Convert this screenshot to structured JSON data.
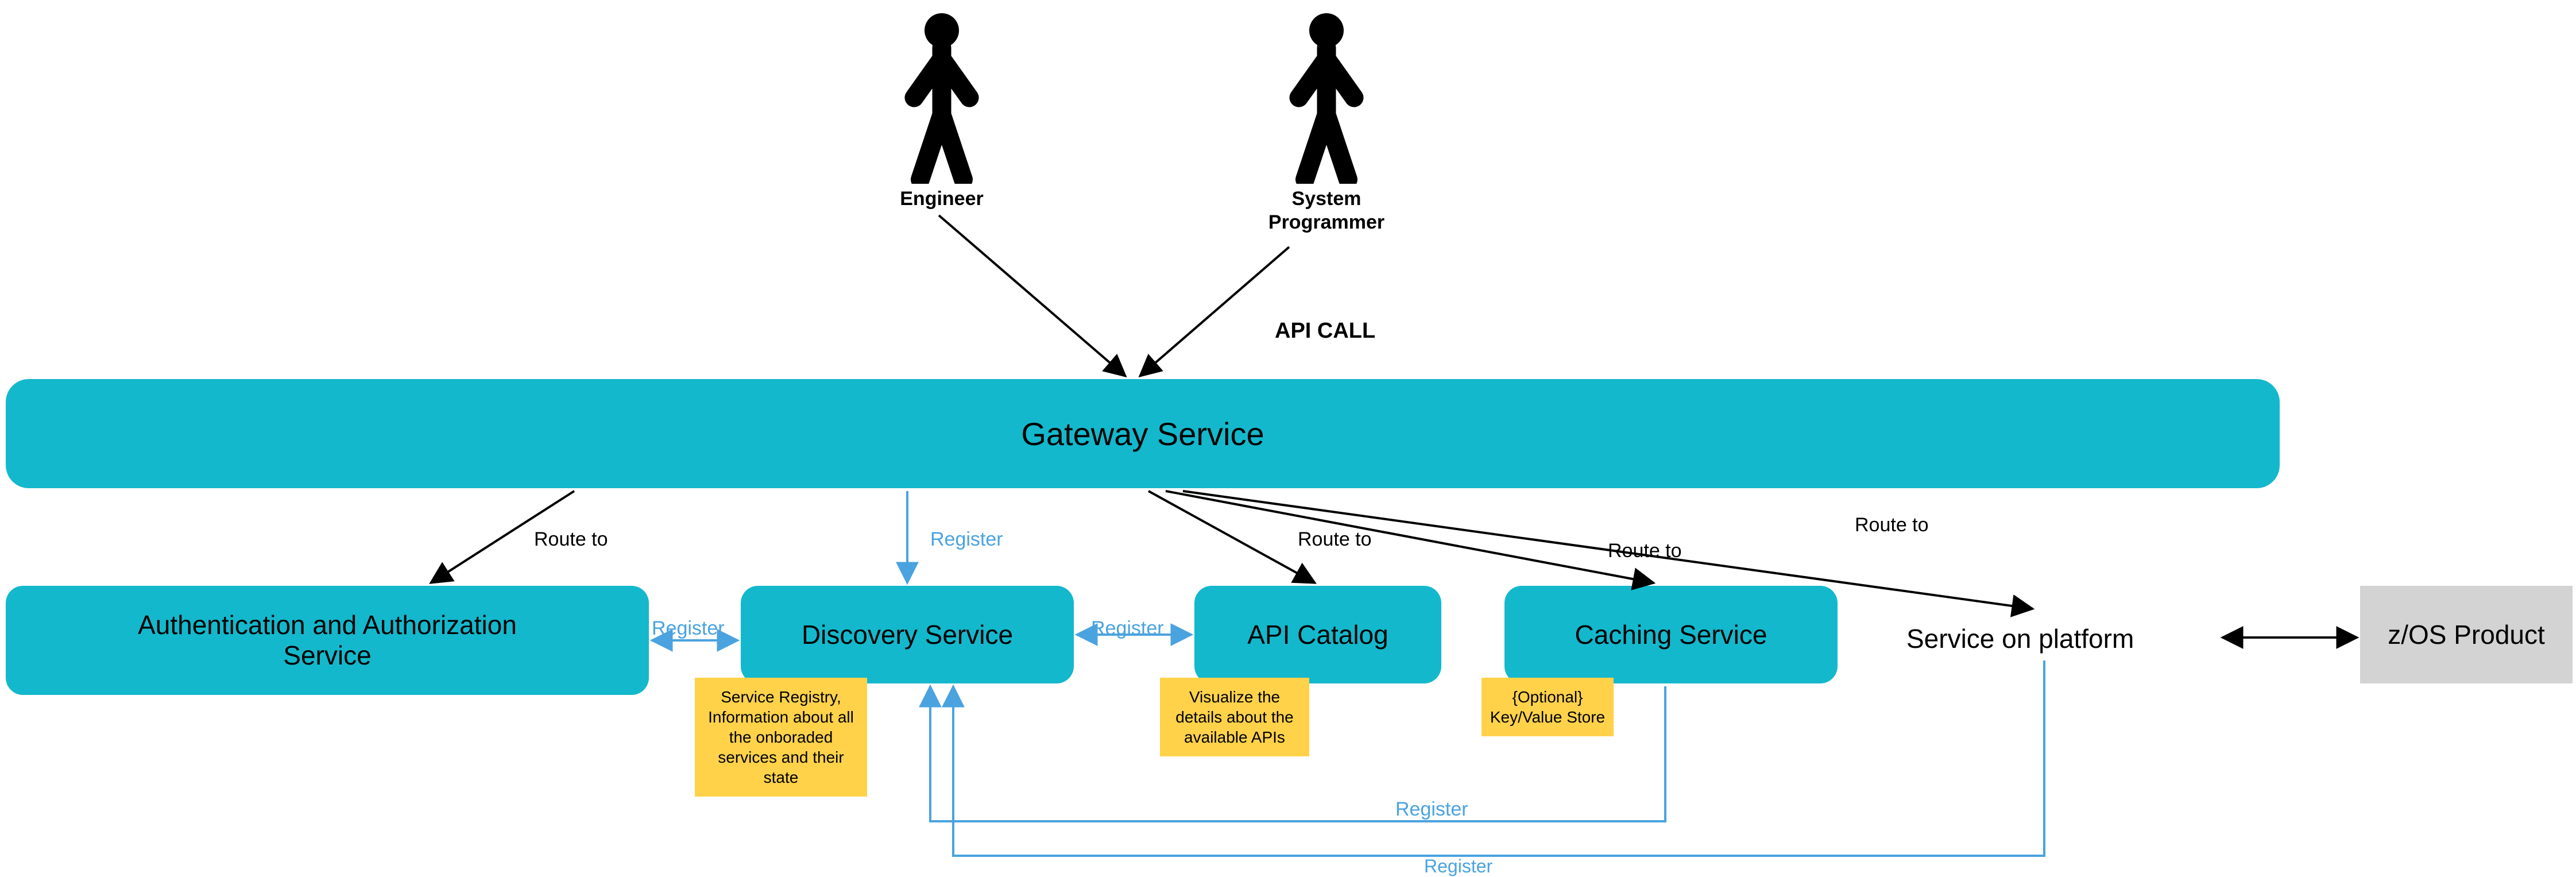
{
  "actors": {
    "engineer": "Engineer",
    "sysprog": "System\nProgrammer"
  },
  "api_call_label": "API CALL",
  "gateway": "Gateway Service",
  "services": {
    "auth": "Authentication and Authorization\nService",
    "discovery": "Discovery Service",
    "api_catalog": "API Catalog",
    "caching": "Caching Service"
  },
  "service_on_platform": "Service on platform",
  "zos": "z/OS Product",
  "notes": {
    "discovery": "Service Registry, Information about all the onboraded services and their state",
    "api_catalog": "Visualize the details about the available APIs",
    "caching": "{Optional} Key/Value Store"
  },
  "edge_labels": {
    "route_to": "Route to",
    "register": "Register"
  },
  "chart_data": {
    "type": "diagram",
    "nodes": [
      {
        "id": "engineer",
        "kind": "actor",
        "label": "Engineer"
      },
      {
        "id": "sysprog",
        "kind": "actor",
        "label": "System Programmer"
      },
      {
        "id": "gateway",
        "kind": "service",
        "label": "Gateway Service"
      },
      {
        "id": "auth",
        "kind": "service",
        "label": "Authentication and Authorization Service"
      },
      {
        "id": "discovery",
        "kind": "service",
        "label": "Discovery Service",
        "note": "Service Registry, Information about all the onboraded services and their state"
      },
      {
        "id": "api_catalog",
        "kind": "service",
        "label": "API Catalog",
        "note": "Visualize the details about the available APIs"
      },
      {
        "id": "caching",
        "kind": "service",
        "label": "Caching Service",
        "note": "{Optional} Key/Value Store"
      },
      {
        "id": "service_on_platform",
        "kind": "platform",
        "label": "Service on platform"
      },
      {
        "id": "zos",
        "kind": "external",
        "label": "z/OS Product"
      }
    ],
    "edges": [
      {
        "from": "engineer",
        "to": "gateway",
        "label": "API CALL"
      },
      {
        "from": "sysprog",
        "to": "gateway",
        "label": "API CALL"
      },
      {
        "from": "gateway",
        "to": "auth",
        "label": "Route to",
        "color": "black"
      },
      {
        "from": "gateway",
        "to": "api_catalog",
        "label": "Route to",
        "color": "black"
      },
      {
        "from": "gateway",
        "to": "caching",
        "label": "Route to",
        "color": "black"
      },
      {
        "from": "gateway",
        "to": "service_on_platform",
        "label": "Route to",
        "color": "black"
      },
      {
        "from": "gateway",
        "to": "discovery",
        "label": "Register",
        "color": "blue"
      },
      {
        "from": "auth",
        "to": "discovery",
        "label": "Register",
        "color": "blue",
        "bidir": true
      },
      {
        "from": "api_catalog",
        "to": "discovery",
        "label": "Register",
        "color": "blue",
        "bidir": true
      },
      {
        "from": "caching",
        "to": "discovery",
        "label": "Register",
        "color": "blue"
      },
      {
        "from": "service_on_platform",
        "to": "discovery",
        "label": "Register",
        "color": "blue"
      },
      {
        "from": "service_on_platform",
        "to": "zos",
        "bidir": true,
        "color": "black"
      }
    ]
  }
}
